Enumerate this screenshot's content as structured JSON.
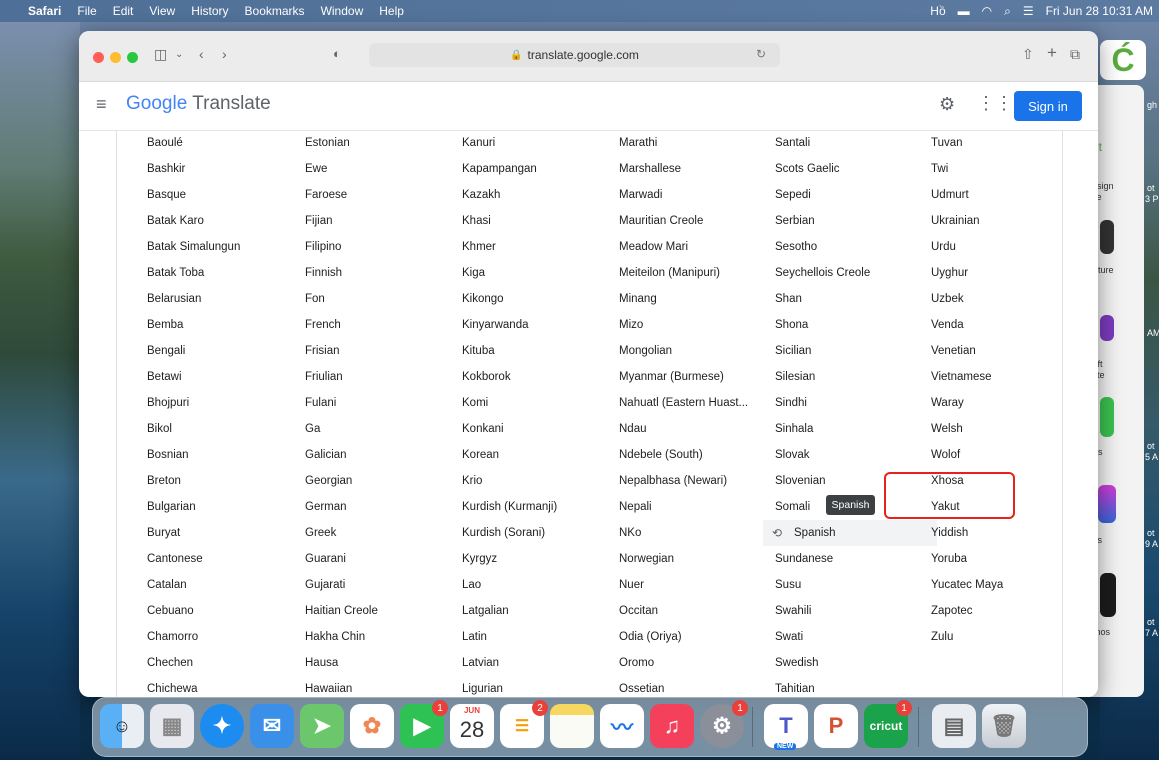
{
  "menubar": {
    "apple": "",
    "app": "Safari",
    "items": [
      "File",
      "Edit",
      "View",
      "History",
      "Bookmarks",
      "Window",
      "Help"
    ],
    "input_source": "Hồ",
    "clock": "Fri Jun 28  10:31 AM"
  },
  "browser": {
    "url": "translate.google.com",
    "colors": {
      "close": "#ff5f57",
      "minimize": "#febc2e",
      "zoom": "#28c840"
    }
  },
  "header": {
    "logo_google": "Google",
    "logo_translate": "Translate",
    "sign_in": "Sign in",
    "accent": "#1a73e8"
  },
  "languages": {
    "col1": [
      "Baoulé",
      "Bashkir",
      "Basque",
      "Batak Karo",
      "Batak Simalungun",
      "Batak Toba",
      "Belarusian",
      "Bemba",
      "Bengali",
      "Betawi",
      "Bhojpuri",
      "Bikol",
      "Bosnian",
      "Breton",
      "Bulgarian",
      "Buryat",
      "Cantonese",
      "Catalan",
      "Cebuano",
      "Chamorro",
      "Chechen",
      "Chichewa"
    ],
    "col2": [
      "Estonian",
      "Ewe",
      "Faroese",
      "Fijian",
      "Filipino",
      "Finnish",
      "Fon",
      "French",
      "Frisian",
      "Friulian",
      "Fulani",
      "Ga",
      "Galician",
      "Georgian",
      "German",
      "Greek",
      "Guarani",
      "Gujarati",
      "Haitian Creole",
      "Hakha Chin",
      "Hausa",
      "Hawaiian"
    ],
    "col3": [
      "Kanuri",
      "Kapampangan",
      "Kazakh",
      "Khasi",
      "Khmer",
      "Kiga",
      "Kikongo",
      "Kinyarwanda",
      "Kituba",
      "Kokborok",
      "Komi",
      "Konkani",
      "Korean",
      "Krio",
      "Kurdish (Kurmanji)",
      "Kurdish (Sorani)",
      "Kyrgyz",
      "Lao",
      "Latgalian",
      "Latin",
      "Latvian",
      "Ligurian"
    ],
    "col4": [
      "Marathi",
      "Marshallese",
      "Marwadi",
      "Mauritian Creole",
      "Meadow Mari",
      "Meiteilon (Manipuri)",
      "Minang",
      "Mizo",
      "Mongolian",
      "Myanmar (Burmese)",
      "Nahuatl (Eastern Huast...",
      "Ndau",
      "Ndebele (South)",
      "Nepalbhasa (Newari)",
      "Nepali",
      "NKo",
      "Norwegian",
      "Nuer",
      "Occitan",
      "Odia (Oriya)",
      "Oromo",
      "Ossetian"
    ],
    "col5": [
      "Santali",
      "Scots Gaelic",
      "Sepedi",
      "Serbian",
      "Sesotho",
      "Seychellois Creole",
      "Shan",
      "Shona",
      "Sicilian",
      "Silesian",
      "Sindhi",
      "Sinhala",
      "Slovak",
      "Slovenian",
      "Somali",
      "Spanish",
      "Sundanese",
      "Susu",
      "Swahili",
      "Swati",
      "Swedish",
      "Tahitian"
    ],
    "col6": [
      "Tuvan",
      "Twi",
      "Udmurt",
      "Ukrainian",
      "Urdu",
      "Uyghur",
      "Uzbek",
      "Venda",
      "Venetian",
      "Vietnamese",
      "Waray",
      "Welsh",
      "Wolof",
      "Xhosa",
      "Yakut",
      "Yiddish",
      "Yoruba",
      "Yucatec Maya",
      "Zapotec",
      "Zulu"
    ],
    "tooltip": "Spanish",
    "tooltip_trailing": "ish",
    "highlight_color": "#e5221b"
  },
  "side_app": {
    "texts": [
      "ut",
      "esign",
      "ce",
      "apture",
      "soft",
      "ote",
      "ers",
      "uts",
      "emos"
    ],
    "widget_texts": [
      "gh",
      "ot",
      "3 P",
      "AM",
      "ot",
      "5 A",
      "ot",
      "9 A",
      "ot",
      "7 A"
    ]
  },
  "dock": {
    "badges": {
      "facetime": "1",
      "reminders": "2",
      "settings": "1",
      "cricut": "1"
    },
    "calendar_month": "JUN",
    "calendar_day": "28",
    "teams_tag": "NEW",
    "cricut_label": "cricut"
  }
}
